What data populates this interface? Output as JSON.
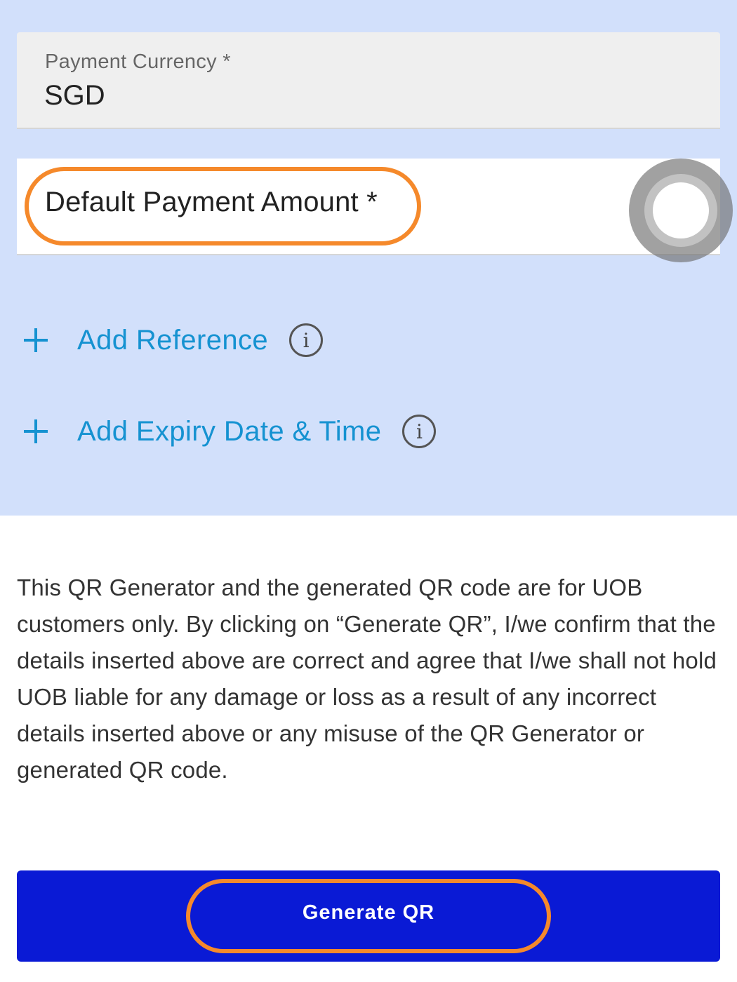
{
  "currency": {
    "label": "Payment Currency *",
    "value": "SGD"
  },
  "amount": {
    "label": "Default Payment Amount *"
  },
  "actions": {
    "add_reference": "Add Reference",
    "add_expiry": "Add Expiry Date & Time",
    "info_glyph": "i"
  },
  "disclaimer": "This QR Generator and the generated QR code are for UOB customers only. By clicking on “Generate QR”, I/we confirm that the details inserted above are correct and agree that I/we shall not hold UOB liable for any damage or loss as a result of any incorrect details inserted above or any misuse of the QR Generator or generated QR code.",
  "button": {
    "generate_label": "Generate QR"
  },
  "colors": {
    "accent": "#1592d1",
    "primary_button": "#0a1ad5",
    "highlight": "#f5892b",
    "form_background": "#d2e0fb"
  },
  "icons": {
    "plus": "plus-icon",
    "info": "info-icon"
  }
}
